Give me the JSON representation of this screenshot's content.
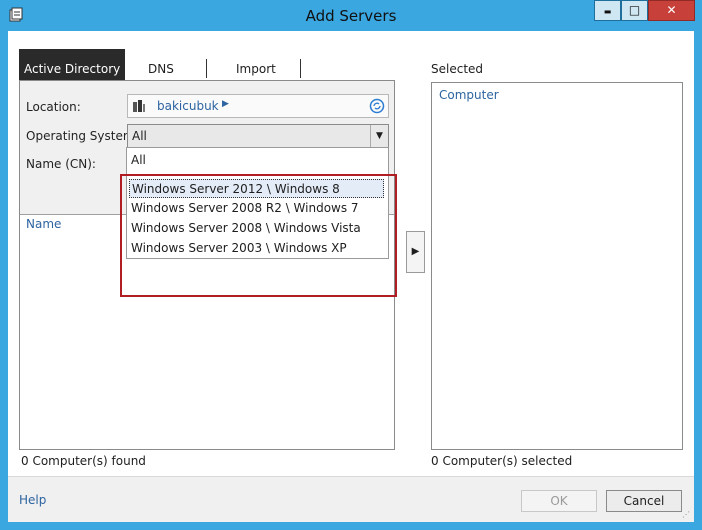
{
  "window": {
    "title": "Add Servers",
    "minimize_glyph": "▬",
    "maximize_glyph": "□",
    "close_glyph": "✕",
    "app_icon": "server-manager-icon"
  },
  "tabs": [
    {
      "label": "Active Directory",
      "active": true
    },
    {
      "label": "DNS",
      "active": false
    },
    {
      "label": "Import",
      "active": false
    }
  ],
  "search_form": {
    "location_label": "Location:",
    "location_value": "bakicubuk",
    "os_label": "Operating System:",
    "os_value": "All",
    "name_label": "Name (CN):"
  },
  "os_dropdown": {
    "options": [
      "All",
      "Windows Server 2012 \\ Windows 8",
      "Windows Server 2008 R2 \\ Windows 7",
      "Windows Server 2008 \\ Windows Vista",
      "Windows Server 2003 \\ Windows XP"
    ],
    "highlighted_index": 1
  },
  "results": {
    "column_name": "Name",
    "found_text": "0 Computer(s) found"
  },
  "add_button_glyph": "▶",
  "selected": {
    "label": "Selected",
    "column": "Computer",
    "count_text": "0 Computer(s) selected"
  },
  "footer": {
    "help": "Help",
    "ok": "OK",
    "cancel": "Cancel"
  },
  "colors": {
    "frame": "#3aa7e1",
    "highlight_border": "#b01e23",
    "link": "#2d64a0"
  }
}
